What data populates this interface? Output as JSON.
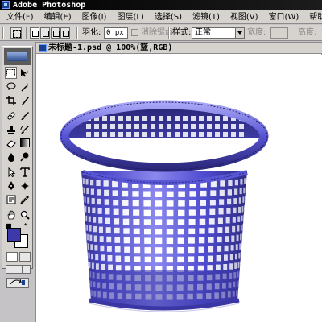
{
  "app": {
    "title": "Adobe Photoshop",
    "icon": "photoshop-icon"
  },
  "menubar": {
    "items": [
      {
        "label": "文件(F)"
      },
      {
        "label": "编辑(E)"
      },
      {
        "label": "图像(I)"
      },
      {
        "label": "图层(L)"
      },
      {
        "label": "选择(S)"
      },
      {
        "label": "滤镜(T)"
      },
      {
        "label": "视图(V)"
      },
      {
        "label": "窗口(W)"
      },
      {
        "label": "帮助(H)"
      }
    ]
  },
  "options": {
    "feather_label": "羽化:",
    "feather_value": "0 px",
    "antialias_label": "消除锯齿",
    "style_label": "样式:",
    "style_value": "正常",
    "width_label": "宽度:",
    "height_label": "高度:"
  },
  "toolbox": {
    "foreground_color": "#3b3aa8",
    "background_color": "#ffffff",
    "tools": [
      "marquee-icon",
      "move-icon",
      "lasso-icon",
      "magic-wand-icon",
      "crop-icon",
      "slice-icon",
      "healing-brush-icon",
      "brush-icon",
      "clone-stamp-icon",
      "history-brush-icon",
      "eraser-icon",
      "gradient-icon",
      "blur-icon",
      "dodge-icon",
      "path-select-icon",
      "type-icon",
      "pen-icon",
      "shape-icon",
      "notes-icon",
      "eyedropper-icon",
      "hand-icon",
      "zoom-icon"
    ]
  },
  "document": {
    "title": "未标题-1.psd @ 100%(篮,RGB)",
    "content": "blue-plastic-mesh-basket",
    "basket_color": "#4a47c4"
  }
}
